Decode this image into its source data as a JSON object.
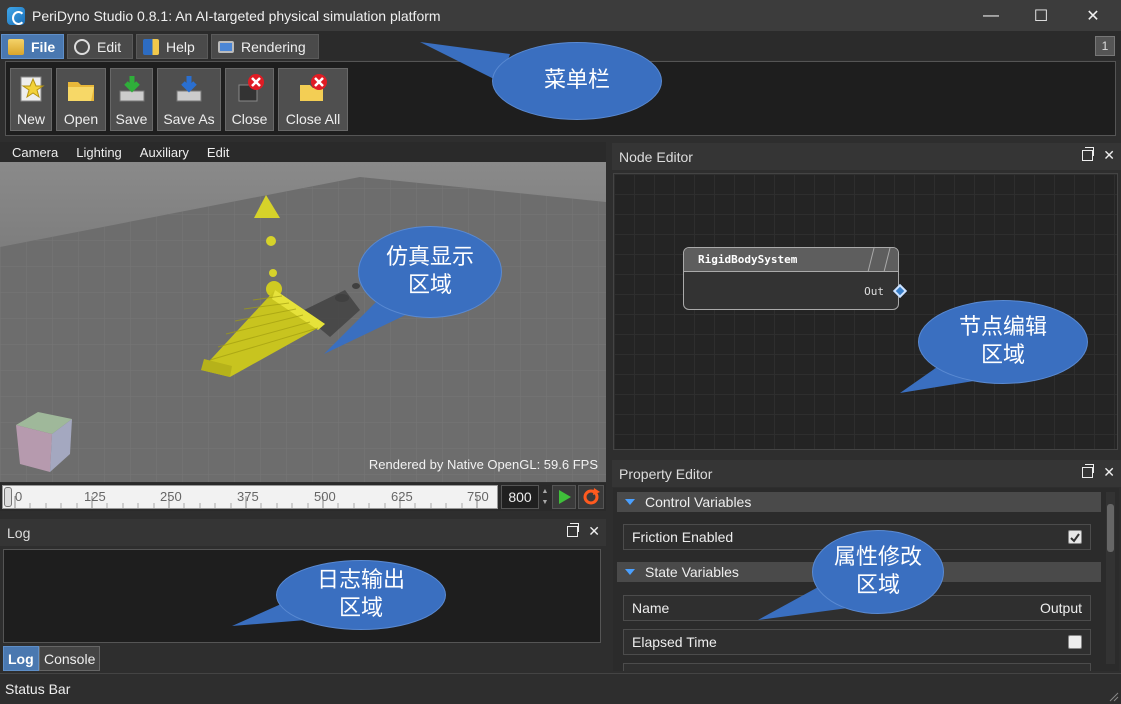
{
  "window": {
    "title": "PeriDyno Studio 0.8.1:  An AI-targeted physical simulation platform",
    "minimize": "—",
    "maximize": "☐",
    "close": "✕"
  },
  "menu_tabs": [
    {
      "label": "File",
      "icon": "folder-icon",
      "active": true
    },
    {
      "label": "Edit",
      "icon": "gear-icon",
      "active": false
    },
    {
      "label": "Help",
      "icon": "book-icon",
      "active": false
    },
    {
      "label": "Rendering",
      "icon": "monitor-icon",
      "active": false
    }
  ],
  "corner_badge": "1",
  "toolbar": [
    {
      "label": "New",
      "icon": "new-scene-icon"
    },
    {
      "label": "Open",
      "icon": "open-folder-icon"
    },
    {
      "label": "Save",
      "icon": "save-icon"
    },
    {
      "label": "Save As",
      "icon": "save-as-icon"
    },
    {
      "label": "Close",
      "icon": "close-scene-icon"
    },
    {
      "label": "Close All",
      "icon": "close-all-icon"
    }
  ],
  "viewport": {
    "menu": [
      "Camera",
      "Lighting",
      "Auxiliary",
      "Edit"
    ],
    "fps_text": "Rendered by Native OpenGL: 59.6 FPS"
  },
  "timeline": {
    "ticks": [
      "0",
      "125",
      "250",
      "375",
      "500",
      "625",
      "750"
    ],
    "frame_value": "800"
  },
  "node_editor": {
    "title": "Node Editor",
    "node_title": "RigidBodySystem",
    "node_port": "Out"
  },
  "property_editor": {
    "title": "Property Editor",
    "sections": [
      "Control Variables",
      "State Variables"
    ],
    "rows": {
      "friction": {
        "label": "Friction Enabled",
        "checked": true
      },
      "name": {
        "label": "Name",
        "value": "Output"
      },
      "elapsed": {
        "label": "Elapsed Time",
        "checked": false
      }
    }
  },
  "log": {
    "title": "Log",
    "tabs": [
      "Log",
      "Console"
    ]
  },
  "status_bar": "Status Bar",
  "callouts": {
    "menu": "菜单栏",
    "sim": [
      "仿真显示",
      "区域"
    ],
    "node": [
      "节点编辑",
      "区域"
    ],
    "property": [
      "属性修改",
      "区域"
    ],
    "log": [
      "日志输出",
      "区域"
    ]
  },
  "colors": {
    "accent": "#4a78b0",
    "callout": "#3a6fc0",
    "cubes": "#d6d22a"
  }
}
